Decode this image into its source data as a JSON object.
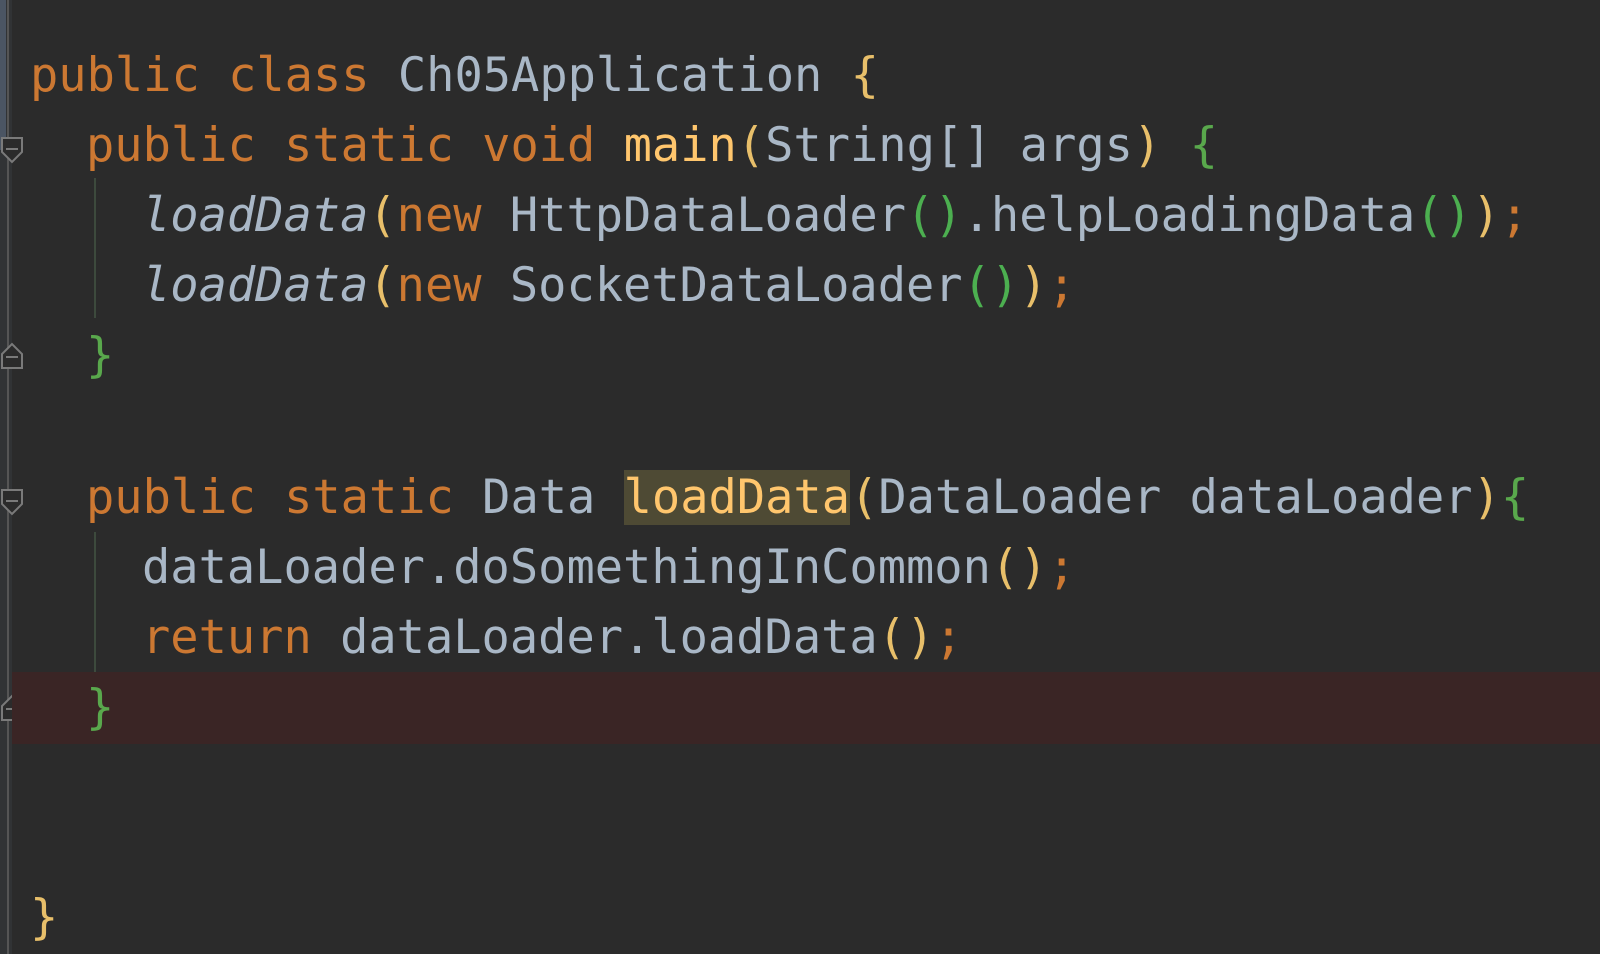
{
  "editor": {
    "language": "Java",
    "colors": {
      "background": "#2b2b2b",
      "keyword": "#cc7832",
      "method_declaration": "#ffc66d",
      "identifier": "#a9b7c6",
      "current_line": "#3a2525",
      "usage_highlight": "#4e4a34"
    },
    "lines": {
      "l1": {
        "public": "public",
        "class": "class",
        "name": "Ch05Application",
        "brace": "{"
      },
      "l2": {
        "public": "public",
        "static": "static",
        "void": "void",
        "method": "main",
        "open": "(",
        "params": "String[] args",
        "close": ")",
        "brace": "{"
      },
      "l3": {
        "call": "loadData",
        "open": "(",
        "new": "new",
        "type": "HttpDataLoader",
        "ctor": "()",
        "chain": ".helpLoadingData",
        "inner": "()",
        "close": ")",
        "semi": ";"
      },
      "l4": {
        "call": "loadData",
        "open": "(",
        "new": "new",
        "type": "SocketDataLoader",
        "ctor": "()",
        "close": ")",
        "semi": ";"
      },
      "l5": {
        "brace": "}"
      },
      "l7": {
        "public": "public",
        "static": "static",
        "type": "Data",
        "method": "loadData",
        "open": "(",
        "params": "DataLoader dataLoader",
        "close": ")",
        "brace": "{"
      },
      "l8": {
        "expr": "dataLoader.doSomethingInCommon",
        "parens": "()",
        "semi": ";"
      },
      "l9": {
        "return": "return",
        "expr": "dataLoader.loadData",
        "parens": "()",
        "semi": ";"
      },
      "l10": {
        "brace": "}"
      },
      "l13": {
        "brace": "}"
      }
    }
  }
}
